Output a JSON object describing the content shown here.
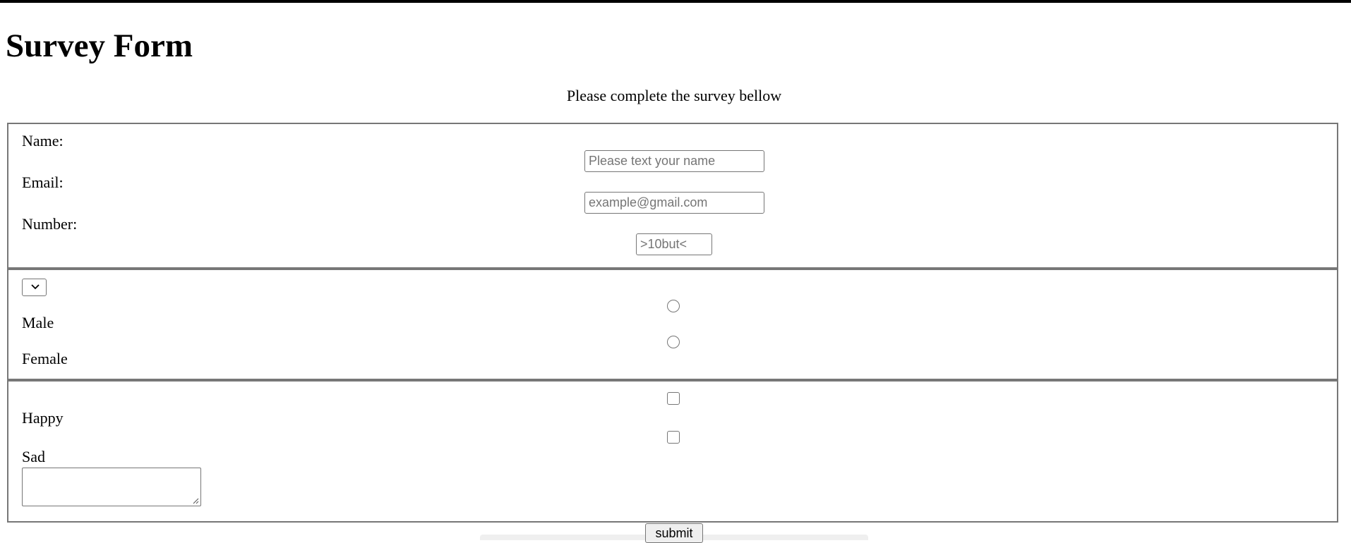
{
  "page": {
    "title": "Survey Form",
    "intro": "Please complete the survey bellow"
  },
  "section1": {
    "name_label": "Name:",
    "name_placeholder": "Please text your name",
    "email_label": "Email:",
    "email_placeholder": "example@gmail.com",
    "number_label": "Number:",
    "number_placeholder": ">10but<"
  },
  "section2": {
    "select_value": "",
    "gender_options": [
      "Male",
      "Female"
    ]
  },
  "section3": {
    "mood_options": [
      "Happy",
      "Sad"
    ],
    "comment_value": ""
  },
  "submit": {
    "label": "submit"
  },
  "colors": {
    "border": "#777777",
    "control_border": "#767676",
    "button_bg": "#efefef"
  }
}
